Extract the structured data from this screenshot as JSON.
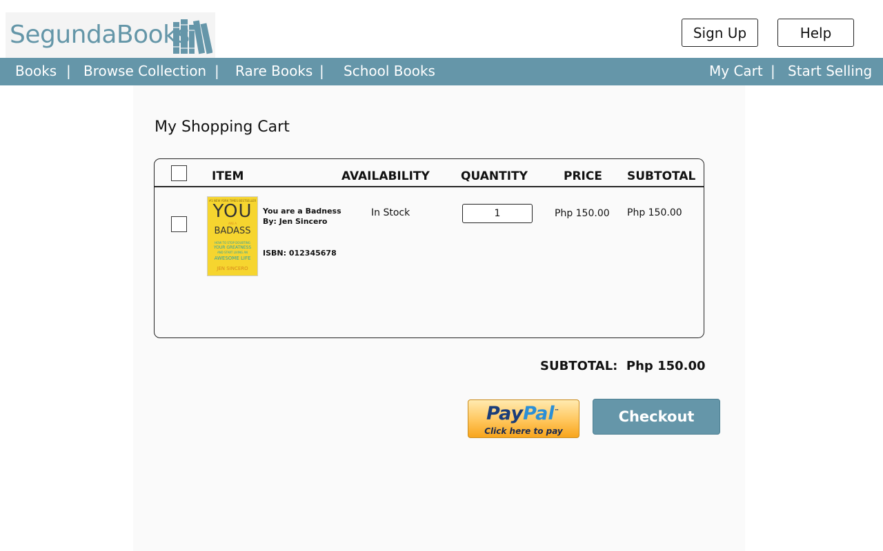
{
  "brand": {
    "name": "SegundaBooks",
    "color": "#6596a9"
  },
  "header": {
    "signup_label": "Sign Up",
    "help_label": "Help"
  },
  "nav": {
    "books": "Books",
    "browse": "Browse Collection",
    "rare": "Rare Books",
    "school": "School Books",
    "cart": "My Cart",
    "sell": "Start Selling",
    "separator": "|"
  },
  "page": {
    "title": "My Shopping Cart"
  },
  "cart": {
    "columns": {
      "item": "ITEM",
      "availability": "AVAILABILITY",
      "quantity": "QUANTITY",
      "price": "PRICE",
      "subtotal": "SUBTOTAL"
    },
    "items": [
      {
        "title": "You are a Badness",
        "author": "By: Jen Sincero",
        "isbn": "ISBN: 012345678",
        "availability": "In Stock",
        "quantity": "1",
        "price": "Php 150.00",
        "subtotal": "Php 150.00",
        "cover": {
          "top_line": "#1 NEW YORK TIMES BESTSELLER",
          "big1": "YOU",
          "small1": "ARE A",
          "big2": "BADASS",
          "sub1": "HOW TO STOP DOUBTING",
          "sub2": "YOUR GREATNESS",
          "sub3": "AND START LIVING AN",
          "sub4": "AWESOME LIFE",
          "author": "JEN SINCERO"
        }
      }
    ]
  },
  "summary": {
    "label": "SUBTOTAL:",
    "value": "Php 150.00"
  },
  "paypal": {
    "logo_dark": "Pay",
    "logo_light": "Pal",
    "tm": "™",
    "caption": "Click here to pay"
  },
  "checkout_label": "Checkout"
}
